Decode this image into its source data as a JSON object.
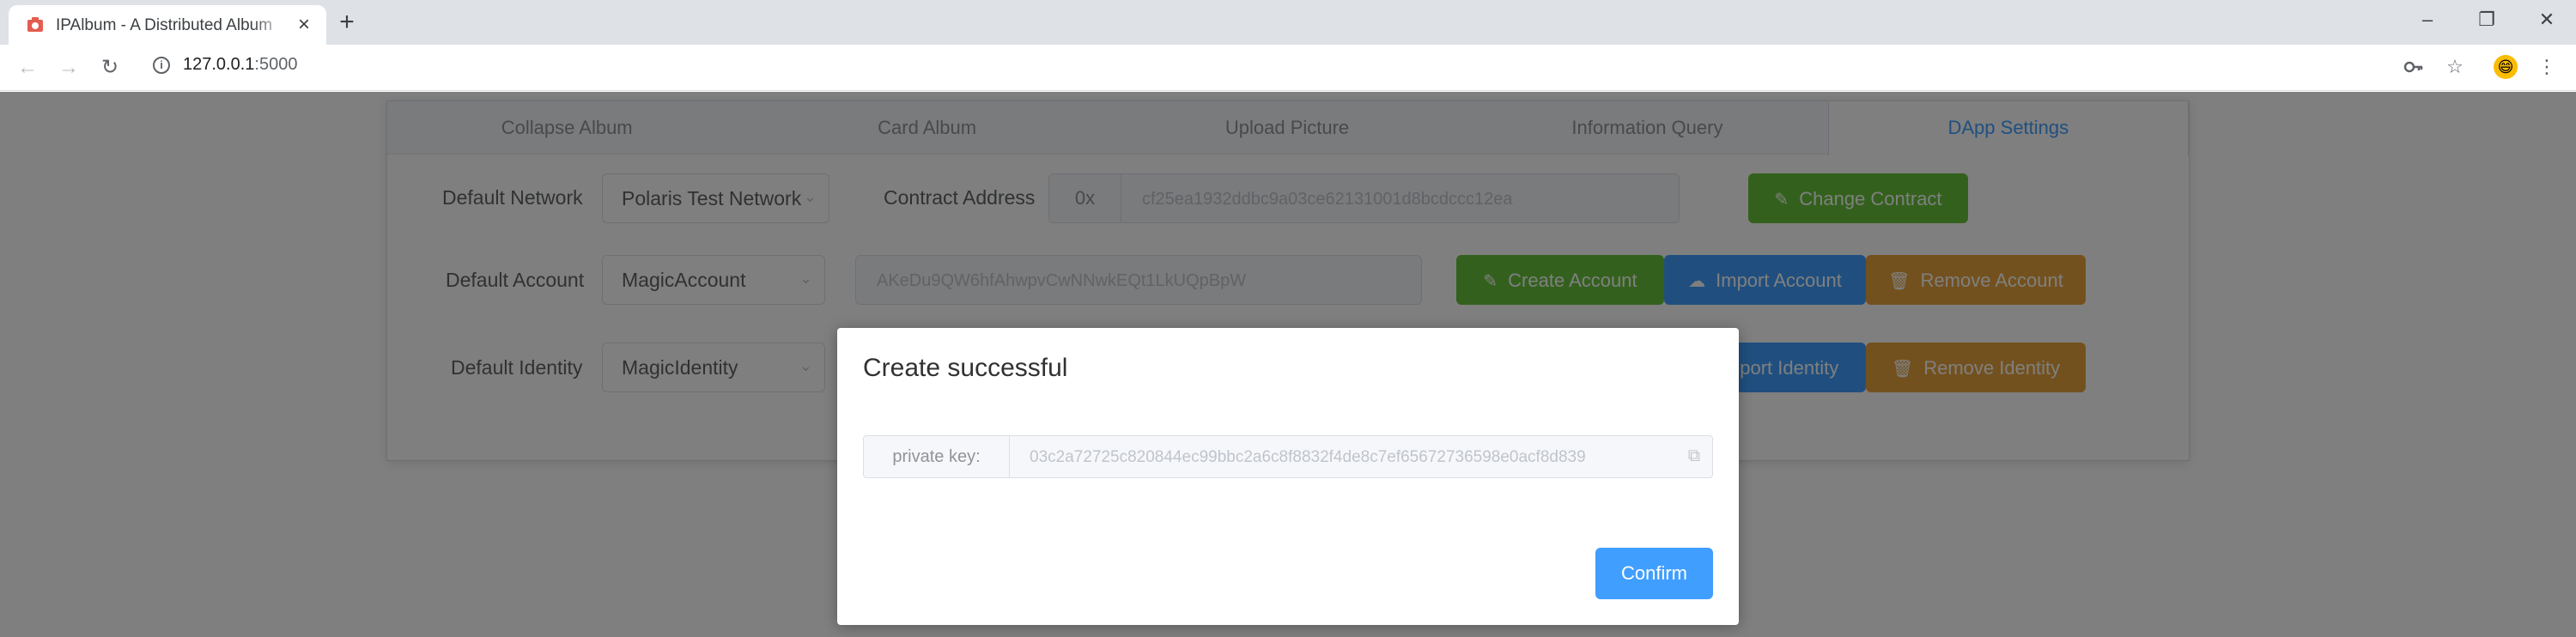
{
  "browser": {
    "tab_title": "IPAlbum - A Distributed Album",
    "url_host": "127.0.0.1",
    "url_port": ":5000",
    "icons": {
      "favicon": "album-favicon-icon",
      "close": "close-icon",
      "new_tab": "plus-icon",
      "back": "arrow-left-icon",
      "forward": "arrow-right-icon",
      "reload": "reload-icon",
      "info": "info-icon",
      "key": "key-icon",
      "star": "star-icon",
      "menu": "more-vert-icon",
      "minimize": "minimize-icon",
      "restore": "restore-icon",
      "window_close": "window-close-icon"
    }
  },
  "tabs": [
    {
      "label": "Collapse Album"
    },
    {
      "label": "Card Album"
    },
    {
      "label": "Upload Picture"
    },
    {
      "label": "Information Query"
    },
    {
      "label": "DApp Settings",
      "active": true
    }
  ],
  "settings": {
    "network_label": "Default Network",
    "network_value": "Polaris Test Network",
    "contract_label": "Contract Address",
    "contract_prefix": "0x",
    "contract_value": "cf25ea1932ddbc9a03ce62131001d8bcdccc12ea",
    "change_contract": "Change Contract",
    "account_label": "Default Account",
    "account_value": "MagicAccount",
    "account_address": "AKeDu9QW6hfAhwpvCwNNwkEQt1LkUQpBpW",
    "create_account": "Create Account",
    "import_account": "Import Account",
    "remove_account": "Remove Account",
    "identity_label": "Default Identity",
    "identity_value": "MagicIdentity",
    "import_identity": "Import Identity",
    "remove_identity": "Remove Identity"
  },
  "dialog": {
    "title": "Create successful",
    "field_label": "private key:",
    "field_value": "03c2a72725c820844ec99bbc2a6c8f8832f4de8c7ef65672736598e0acf8d839",
    "confirm": "Confirm"
  },
  "colors": {
    "primary": "#409eff",
    "success": "#67c23a",
    "warning": "#e6a23c"
  }
}
